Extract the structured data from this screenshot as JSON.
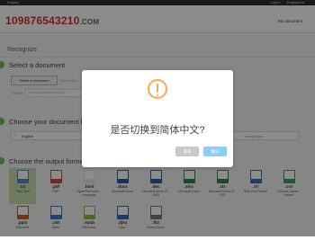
{
  "topbar": {
    "language": "English",
    "login": "Log in",
    "register": "Registered"
  },
  "header": {
    "logo_number": "109876543210",
    "logo_suffix": ".COM",
    "my_document": "My document"
  },
  "section": {
    "title": "Recognize"
  },
  "steps": {
    "select_document": {
      "title": "Select a document",
      "button": "Select a document",
      "hint": "Files under ...",
      "url_label": "Website",
      "url_placeholder": "(url.jpg/png/pdf/bmp/tif/jpe)"
    },
    "language": {
      "title": "Choose your document lan",
      "selected": "English",
      "right_placeholder": "e language..."
    },
    "format": {
      "title": "Choose the output format",
      "formats": [
        {
          "ext": ".txt",
          "name": "Plain Text",
          "color": "#5c87c8"
        },
        {
          "ext": ".pdf",
          "name": "PDF",
          "color": "#d44a3e"
        },
        {
          "ext": ".html",
          "name": "HyperText Mark... Language",
          "color": "#e6e6e6"
        },
        {
          "ext": ".docx",
          "name": "Microsoft Word",
          "color": "#2f5fa8"
        },
        {
          "ext": ".doc",
          "name": "Microsoft Word 97-2003",
          "color": "#2f5fa8"
        },
        {
          "ext": ".xlsx",
          "name": "Microsoft Excel",
          "color": "#2d8a4c"
        },
        {
          "ext": ".xls",
          "name": "Microsoft Excel 97-200",
          "color": "#2d8a4c"
        },
        {
          "ext": ".rtf",
          "name": "Rich Text Format",
          "color": "#3f6cc8"
        },
        {
          "ext": ".csv",
          "name": "Comma-Separ... Values",
          "color": "#35a35a"
        },
        {
          "ext": ".pptx",
          "name": "Microsoft",
          "color": "#d35a2f"
        },
        {
          "ext": ".odt",
          "name": "Open",
          "color": "#3a79c7"
        },
        {
          "ext": ".epub",
          "name": "Electronic",
          "color": "#8bbd3c"
        },
        {
          "ext": ".djvu",
          "name": "Djvu",
          "color": "#3b66b8"
        },
        {
          "ext": ".fb2",
          "name": "Fiction Book",
          "color": "#777777"
        }
      ]
    }
  },
  "dialog": {
    "title": "是否切换到简体中文?",
    "cancel_label": "取消",
    "ok_label": "确认",
    "warning_color": "#f6a95b"
  }
}
